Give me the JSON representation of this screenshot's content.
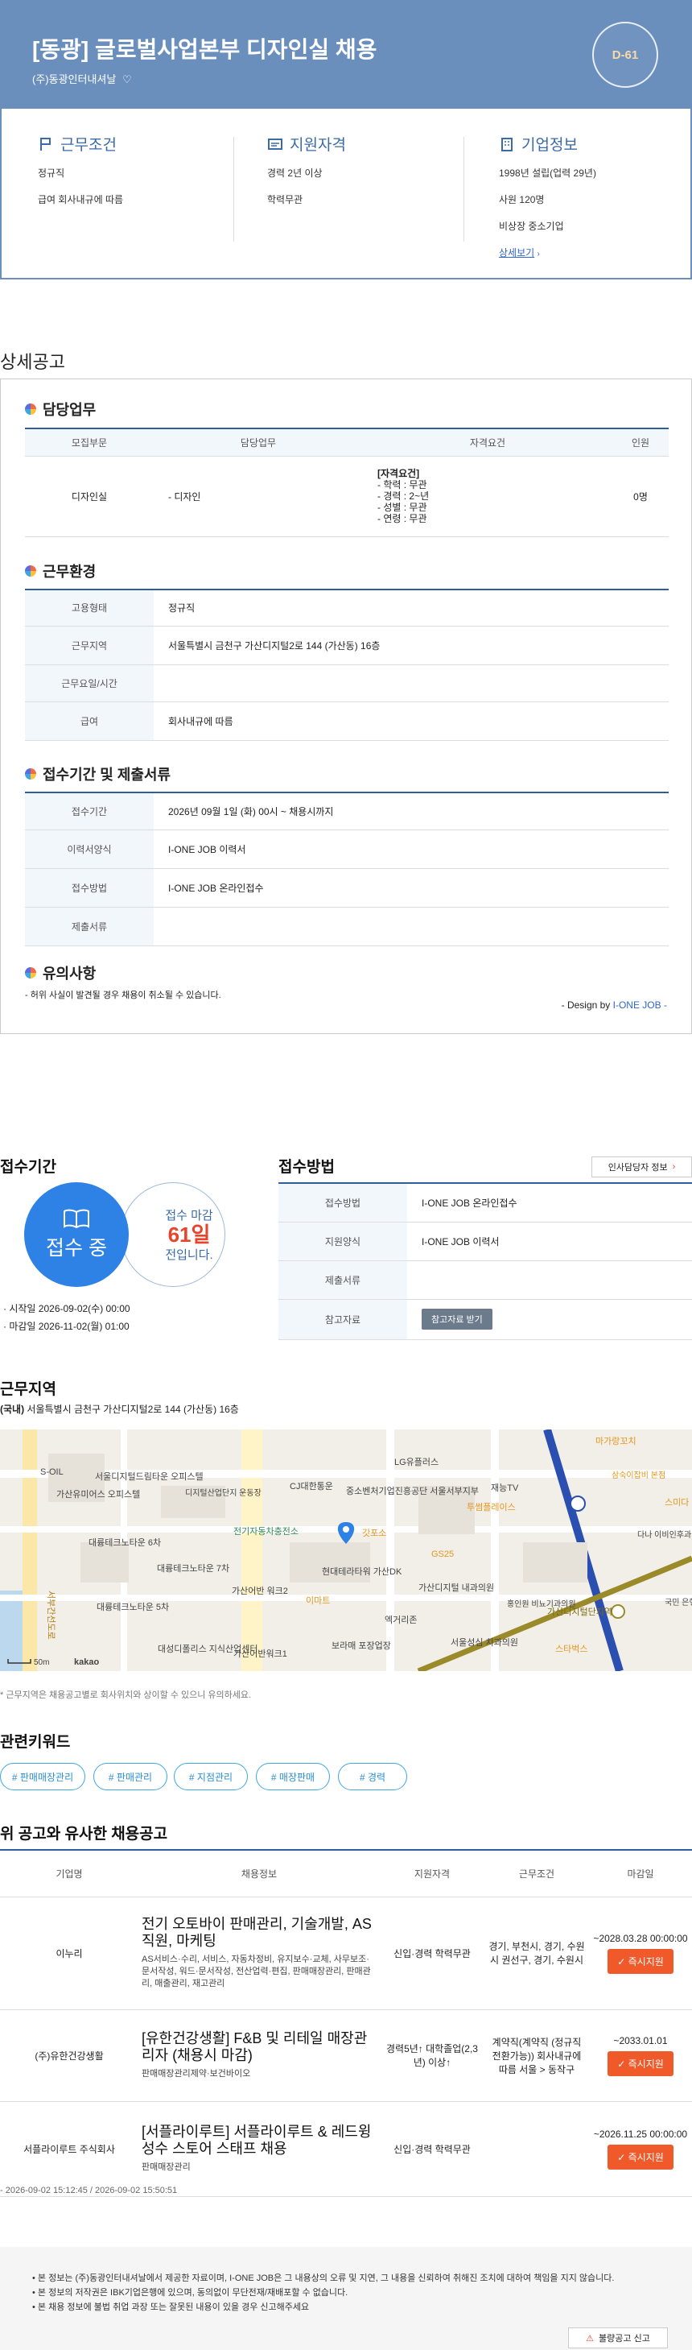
{
  "header": {
    "title": "[동광] 글로벌사업본부 디자인실 채용",
    "company": "(주)동광인터내셔날",
    "dday": "D-61"
  },
  "summary": {
    "work": {
      "title": "근무조건",
      "lines": [
        "정규직",
        "급여 회사내규에 따름"
      ]
    },
    "qual": {
      "title": "지원자격",
      "lines": [
        "경력 2년 이상",
        "학력무관"
      ]
    },
    "company": {
      "title": "기업정보",
      "lines": [
        "1998년 설립(업력 29년)",
        "사원 120명",
        "비상장 중소기업"
      ],
      "link": "상세보기"
    }
  },
  "detail": {
    "label": "상세공고",
    "duty": {
      "title": "담당업무",
      "headers": [
        "모집부문",
        "담당업무",
        "자격요건",
        "인원"
      ],
      "row": {
        "dept": "디자인실",
        "task": "- 디자인",
        "req_title": "[자격요건]",
        "req_lines": [
          "- 학력 : 무관",
          "- 경력 : 2~년",
          "- 성별 : 무관",
          "- 연령 : 무관"
        ],
        "count": "0명"
      }
    },
    "env": {
      "title": "근무환경",
      "rows": [
        {
          "k": "고용형태",
          "v": "정규직"
        },
        {
          "k": "근무지역",
          "v": "서울특별시 금천구 가산디지털2로 144 (가산동) 16층"
        },
        {
          "k": "근무요일/시간",
          "v": ""
        },
        {
          "k": "급여",
          "v": "회사내규에 따름"
        }
      ]
    },
    "period": {
      "title": "접수기간 및 제출서류",
      "rows": [
        {
          "k": "접수기간",
          "v": "2026년 09월 1일 (화) 00시 ~ 채용시까지"
        },
        {
          "k": "이력서양식",
          "v": "I-ONE JOB 이력서"
        },
        {
          "k": "접수방법",
          "v": "I-ONE JOB 온라인접수"
        },
        {
          "k": "제출서류",
          "v": ""
        }
      ]
    },
    "notice": {
      "title": "유의사항",
      "text": "- 허위 사실이 발견될 경우 채용이 취소될 수 있습니다.",
      "design_prefix": "- Design by ",
      "design_brand": "I-ONE JOB",
      "design_suffix": " -"
    }
  },
  "apply": {
    "title": "접수기간",
    "status": "접수 중",
    "deadline_label": "접수 마감",
    "days": "61일",
    "days_suffix": "전입니다.",
    "start": "시작일 2026-09-02(수) 00:00",
    "end": "마감일 2026-11-02(월) 01:00"
  },
  "method": {
    "title": "접수방법",
    "hr_button": "인사담당자 정보",
    "rows": [
      {
        "k": "접수방법",
        "v": "I-ONE JOB 온라인접수"
      },
      {
        "k": "지원양식",
        "v": "I-ONE JOB 이력서"
      },
      {
        "k": "제출서류",
        "v": ""
      },
      {
        "k": "참고자료",
        "v": ""
      }
    ],
    "ref_button": "참고자료 받기"
  },
  "location": {
    "title": "근무지역",
    "prefix": "(국내)",
    "address": "서울특별시 금천구 가산디지털2로 144 (가산동) 16층",
    "note": "* 근무지역은 채용공고별로 회사위치와 상이할 수 있으니 유의하세요.",
    "map_labels": {
      "l1": "S-OIL",
      "l2": "가산유미어스 오피스텔",
      "l3": "서울디지털드림타운 오피스텔",
      "l4": "디지털산업단지 운동장",
      "l5": "CJ대한통운",
      "l6": "LG유플러스",
      "l7": "중소벤처기업진흥공단 서울서부지부",
      "l8": "재능TV",
      "l9": "투썸플레이스",
      "l10": "대륭테크노타운 6차",
      "l11": "전기자동차충전소",
      "l12": "대륭테크노타운 7차",
      "l13": "갓포소",
      "l14": "현대테라타워 가산DK",
      "l15": "GS25",
      "l16": "가산디지털 내과의원",
      "l17": "대륭테크노타운 5차",
      "l18": "가산어반 워크2",
      "l19": "이마트",
      "l20": "엑거리존",
      "l21": "대성디폴리스 지식산업센터",
      "l22": "가산어반워크1",
      "l23": "보라매 포장업장",
      "l24": "서울성심 치과의원",
      "l25": "가산디지털단지역",
      "l26": "스타벅스",
      "l27": "마가랑꼬치",
      "l28": "삼숙이잡비 본점",
      "l29": "스미다",
      "l30": "다나 이비인후과",
      "l31": "국민 은행",
      "l32": "홍인원 비뇨기과의원",
      "l33": "서부간선도로",
      "scale": "50m",
      "brand": "kakao"
    }
  },
  "keywords": {
    "title": "관련키워드",
    "items": [
      "# 판매매장관리",
      "# 판매관리",
      "# 지점관리",
      "# 매장판매",
      "# 경력"
    ]
  },
  "similar": {
    "title": "위 공고와 유사한 채용공고",
    "headers": [
      "기업명",
      "채용정보",
      "지원자격",
      "근무조건",
      "마감일"
    ],
    "rows": [
      {
        "company": "이누리",
        "title": "전기 오토바이 판매관리, 기술개발, AS직원, 마케팅",
        "sub": "AS서비스·수리, 서비스, 자동차정비, 유지보수·교체, 사무보조·문서작성, 워드·문서작성, 전산업력·편집, 판매매장관리, 판매관리, 매출관리, 재고관리",
        "qual": "신입·경력 학력무관",
        "cond": "경기, 부천시, 경기, 수원시 권선구, 경기, 수원시",
        "deadline": "~2028.03.28 00:00:00",
        "button": "즉시지원"
      },
      {
        "company": "(주)유한건강생활",
        "title": "[유한건강생활] F&B 및 리테일 매장관리자 (채용시 마감)",
        "sub": "판매매장관리제약·보건바이오",
        "qual": "경력5년↑ 대학졸업(2,3년) 이상↑",
        "cond": "계약직(계약직 (정규직 전환가능)) 회사내규에 따름 서울 > 동작구",
        "deadline": "~2033.01.01",
        "button": "즉시지원"
      },
      {
        "company": "서플라이루트 주식회사",
        "title": "[서플라이루트] 서플라이루트 & 레드윙 성수 스토어 스태프 채용",
        "sub": "판매매장관리",
        "qual": "신입·경력 학력무관",
        "cond": "",
        "deadline": "~2026.11.25 00:00:00",
        "button": "즉시지원"
      }
    ]
  },
  "timestamps": "- 2026-09-02 15:12:45 / 2026-09-02 15:50:51",
  "footer": {
    "lines": [
      "본 정보는 (주)동광인터내셔날에서 제공한 자료이며, I-ONE JOB은 그 내용상의 오류 및 지연, 그 내용을 신뢰하여 취해진 조치에 대하여 책임을 지지 않습니다.",
      "본 정보의 저작권은 IBK기업은행에 있으며, 동의없이 무단전재/재배포할 수 없습니다.",
      "본 채용 정보에 불법 취업 과장 또는 잘못된 내용이 있을 경우 신고해주세요"
    ],
    "report": "불량공고 신고"
  }
}
